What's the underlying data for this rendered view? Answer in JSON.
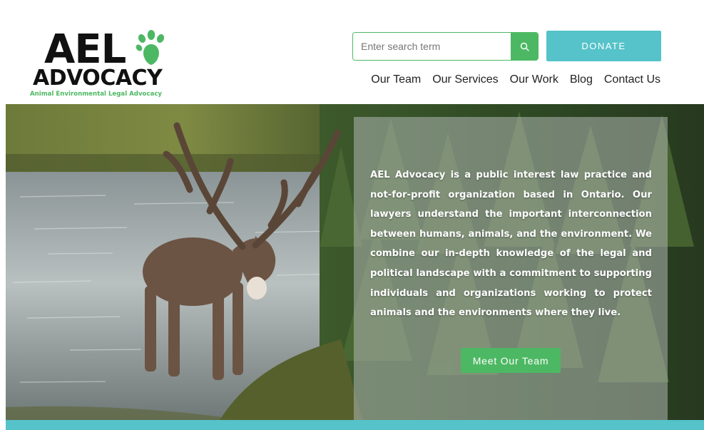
{
  "colors": {
    "brand_green": "#4db863",
    "brand_teal": "#55c3c9",
    "text_dark": "#111111"
  },
  "logo": {
    "ael": "AEL",
    "advocacy": "ADVOCACY",
    "tagline": "Animal Environmental Legal Advocacy",
    "icon": "paw-icon"
  },
  "search": {
    "placeholder": "Enter search term",
    "value": "",
    "icon": "search-icon"
  },
  "donate": {
    "label": "DONATE"
  },
  "nav": {
    "items": [
      {
        "label": "Our Team"
      },
      {
        "label": "Our Services"
      },
      {
        "label": "Our Work"
      },
      {
        "label": "Blog"
      },
      {
        "label": "Contact Us"
      }
    ]
  },
  "hero": {
    "body": "AEL Advocacy is a public interest law practice and not-for-profit organization based in Ontario. Our lawyers understand the important interconnection between humans, animals, and the environment. We combine our in-depth knowledge of the legal and political landscape with a commitment to supporting individuals and organizations working to protect animals and the environments where they live.",
    "cta_label": "Meet Our Team"
  }
}
